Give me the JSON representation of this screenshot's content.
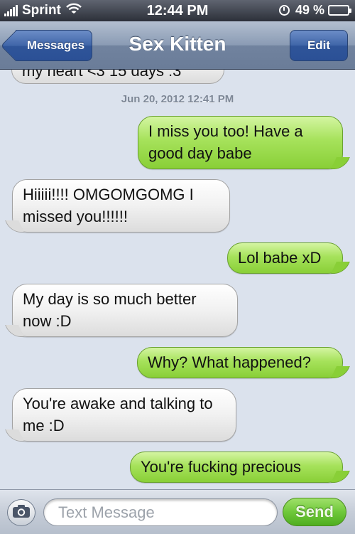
{
  "status_bar": {
    "carrier": "Sprint",
    "time": "12:44 PM",
    "battery_percent": "49 %",
    "battery_level": 0.49
  },
  "nav": {
    "back_label": "Messages",
    "title": "Sex Kitten",
    "edit_label": "Edit"
  },
  "conversation": {
    "partial_previous_message": "my heart <3 15 days :3",
    "timestamp": "Jun 20, 2012 12:41 PM",
    "messages": [
      {
        "sender": "me",
        "text": "I miss you too! Have a good day babe"
      },
      {
        "sender": "contact",
        "text": "Hiiiii!!!! OMGOMGOMG I missed you!!!!!!"
      },
      {
        "sender": "me",
        "text": "Lol babe xD"
      },
      {
        "sender": "contact",
        "text": "My day is so much better now :D"
      },
      {
        "sender": "me",
        "text": "Why? What happened?"
      },
      {
        "sender": "contact",
        "text": "You're awake and talking to me :D"
      },
      {
        "sender": "me",
        "text": "You're fucking precious"
      }
    ]
  },
  "input_bar": {
    "placeholder": "Text Message",
    "value": "",
    "send_label": "Send"
  },
  "colors": {
    "outgoing_bubble": "#a6e25b",
    "incoming_bubble": "#f1f1f1",
    "background": "#dbe2ed",
    "nav_button": "#3f65a8",
    "send_button": "#6fc83a"
  },
  "icons": [
    "signal-bars-icon",
    "wifi-icon",
    "alarm-clock-icon",
    "battery-icon",
    "camera-icon"
  ]
}
